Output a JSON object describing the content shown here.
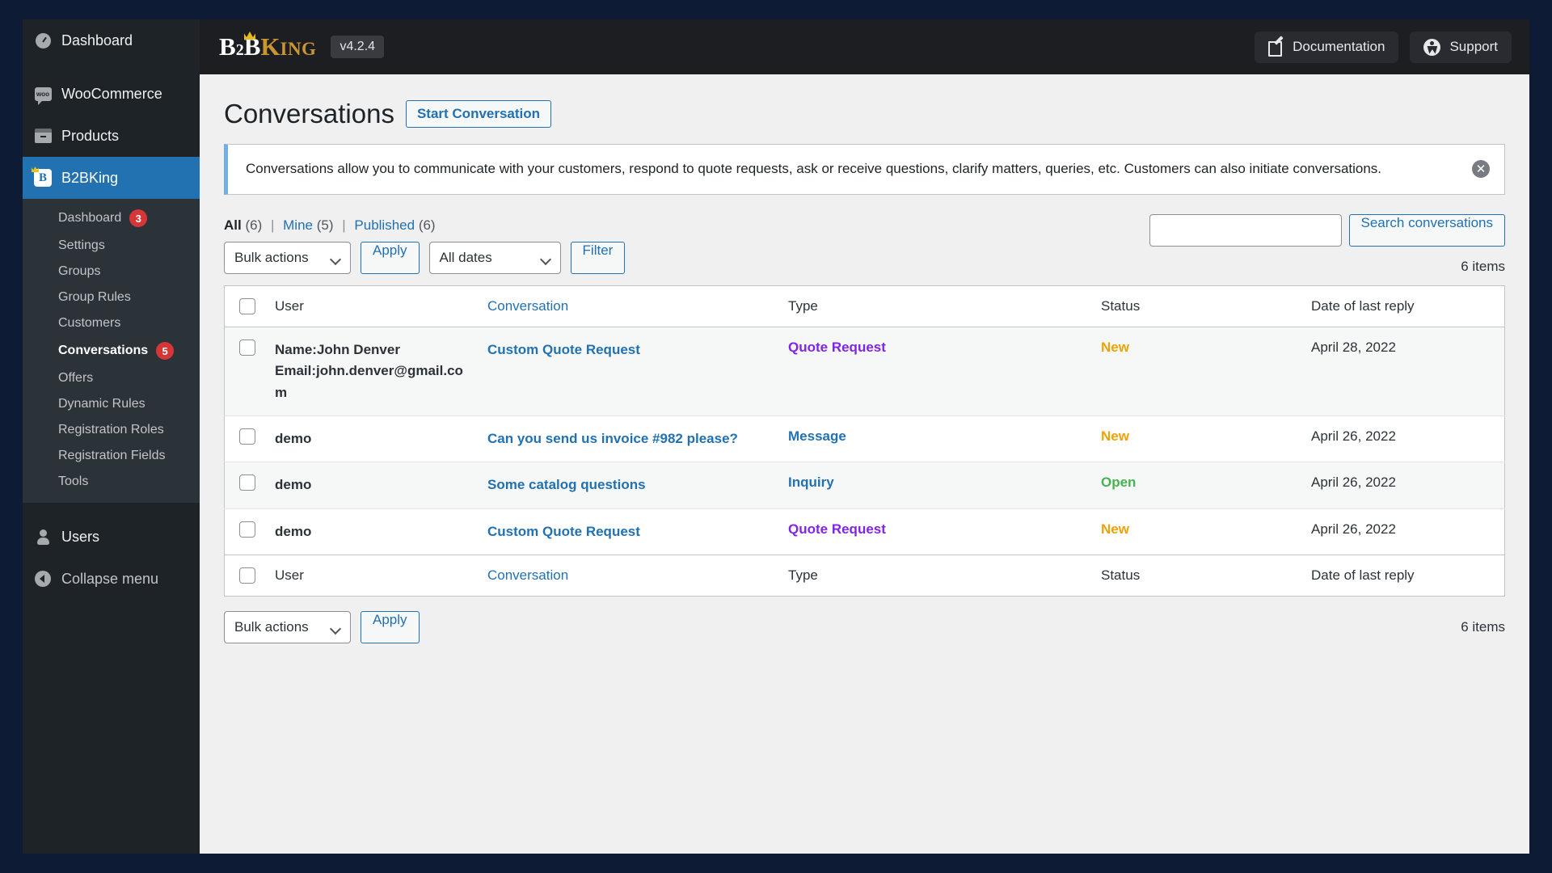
{
  "wp_sidebar": {
    "top_items": [
      {
        "label": "Dashboard",
        "icon": "dashboard-icon"
      },
      {
        "label": "WooCommerce",
        "icon": "woocommerce-icon"
      },
      {
        "label": "Products",
        "icon": "products-icon"
      },
      {
        "label": "B2BKing",
        "icon": "b2bking-icon",
        "active": true
      }
    ],
    "sub_items": [
      {
        "label": "Dashboard",
        "badge": "3"
      },
      {
        "label": "Settings",
        "badge": ""
      },
      {
        "label": "Groups",
        "badge": ""
      },
      {
        "label": "Group Rules",
        "badge": ""
      },
      {
        "label": "Customers",
        "badge": ""
      },
      {
        "label": "Conversations",
        "badge": "5",
        "current": true
      },
      {
        "label": "Offers",
        "badge": ""
      },
      {
        "label": "Dynamic Rules",
        "badge": ""
      },
      {
        "label": "Registration Roles",
        "badge": ""
      },
      {
        "label": "Registration Fields",
        "badge": ""
      },
      {
        "label": "Tools",
        "badge": ""
      }
    ],
    "footer_items": [
      {
        "label": "Users",
        "icon": "user-icon"
      },
      {
        "label": "Collapse menu",
        "icon": "collapse-icon"
      }
    ]
  },
  "plugin_header": {
    "logo": {
      "b": "B",
      "two": "2",
      "b2": "B",
      "k": "K",
      "ing": "ING"
    },
    "version": "v4.2.4",
    "documentation_label": "Documentation",
    "support_label": "Support"
  },
  "page": {
    "title": "Conversations",
    "start_conversation_label": "Start Conversation",
    "notice_text": "Conversations allow you to communicate with your customers, respond to quote requests, ask or receive questions, clarify matters, queries, etc. Customers can also initiate conversations.",
    "dismiss_glyph": "✕"
  },
  "views": {
    "all_label": "All",
    "all_count": "(6)",
    "mine_label": "Mine",
    "mine_count": "(5)",
    "published_label": "Published",
    "published_count": "(6)",
    "separator": "|"
  },
  "search": {
    "value": "",
    "placeholder": "",
    "button_label": "Search conversations"
  },
  "tablenav_top": {
    "bulk_actions_label": "Bulk actions",
    "apply_label": "Apply",
    "dates_label": "All dates",
    "filter_label": "Filter",
    "items_count": "6 items"
  },
  "tablenav_bottom": {
    "bulk_actions_label": "Bulk actions",
    "apply_label": "Apply",
    "items_count": "6 items"
  },
  "table": {
    "columns": {
      "user": "User",
      "conversation": "Conversation",
      "type": "Type",
      "status": "Status",
      "date": "Date of last reply"
    },
    "colors": {
      "link": "#2271b1",
      "quote_request": "#8224e3",
      "message": "#2271b1",
      "inquiry": "#2271b1",
      "status_new": "#f0a202",
      "status_open": "#46b450"
    },
    "rows": [
      {
        "user": "Name:John Denver Email:john.denver@gmail.com",
        "conversation": "Custom Quote Request",
        "type": "Quote Request",
        "type_color": "#8224e3",
        "status": "New",
        "status_color": "#f0a202",
        "date": "April 28, 2022"
      },
      {
        "user": "demo",
        "conversation": "Can you send us invoice #982 please?",
        "type": "Message",
        "type_color": "#2271b1",
        "status": "New",
        "status_color": "#f0a202",
        "date": "April 26, 2022"
      },
      {
        "user": "demo",
        "conversation": "Some catalog questions",
        "type": "Inquiry",
        "type_color": "#2271b1",
        "status": "Open",
        "status_color": "#46b450",
        "date": "April 26, 2022"
      },
      {
        "user": "demo",
        "conversation": "Custom Quote Request",
        "type": "Quote Request",
        "type_color": "#8224e3",
        "status": "New",
        "status_color": "#f0a202",
        "date": "April 26, 2022"
      }
    ]
  }
}
